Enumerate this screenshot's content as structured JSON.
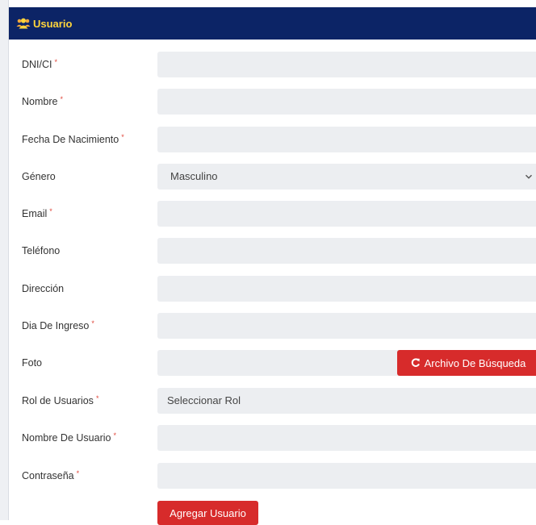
{
  "header": {
    "title": "Usuario",
    "icon": "users-icon"
  },
  "form": {
    "dni": {
      "label": "DNI/CI",
      "required_mark": "*",
      "value": ""
    },
    "nombre": {
      "label": "Nombre",
      "required_mark": "*",
      "value": ""
    },
    "fecha": {
      "label": "Fecha De Nacimiento",
      "required_mark": "*",
      "value": ""
    },
    "genero": {
      "label": "Género",
      "selected": "Masculino"
    },
    "email": {
      "label": "Email",
      "required_mark": "*",
      "value": ""
    },
    "telefono": {
      "label": "Teléfono",
      "value": ""
    },
    "direccion": {
      "label": "Dirección",
      "value": ""
    },
    "ingreso": {
      "label": "Dia De Ingreso",
      "required_mark": "*",
      "value": ""
    },
    "foto": {
      "label": "Foto",
      "browse_label": "Archivo De Búsqueda"
    },
    "rol": {
      "label": "Rol de Usuarios",
      "required_mark": "*",
      "placeholder": "Seleccionar Rol"
    },
    "usuario": {
      "label": "Nombre De Usuario",
      "required_mark": "*",
      "value": ""
    },
    "password": {
      "label": "Contraseña",
      "required_mark": "*",
      "value": ""
    },
    "submit_label": "Agregar Usuario"
  },
  "colors": {
    "header_bg": "#0c2466",
    "header_text": "#ffd43b",
    "accent": "#d72b2b",
    "field_bg": "#eceef1"
  }
}
